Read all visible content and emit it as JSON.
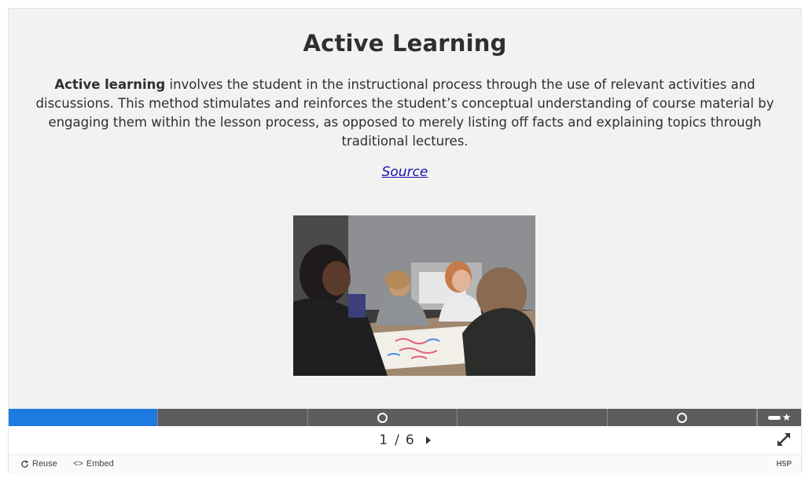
{
  "slide": {
    "title": "Active Learning",
    "body_bold": "Active learning",
    "body_rest": " involves the student in the instructional process through the use of relevant activities and discussions. This method stimulates and reinforces the student’s conceptual understanding of course material by engaging them within the lesson process, as opposed to merely listing off facts and explaining topics through traditional lectures.",
    "source_link": "Source",
    "image_icon": "photo-students-group-work"
  },
  "progress": {
    "current": 1,
    "total": 6,
    "active_color": "#1f7ae0",
    "task_slides": [
      3,
      5
    ],
    "summary_icon": "star-icon"
  },
  "navigation": {
    "current": "1",
    "separator": "/",
    "total": "6",
    "next_icon": "next-arrow-icon",
    "fullscreen_icon": "fullscreen-expand-icon"
  },
  "h5p_bar": {
    "reuse_label": "Reuse",
    "embed_label": "Embed",
    "logo": "H5P"
  }
}
